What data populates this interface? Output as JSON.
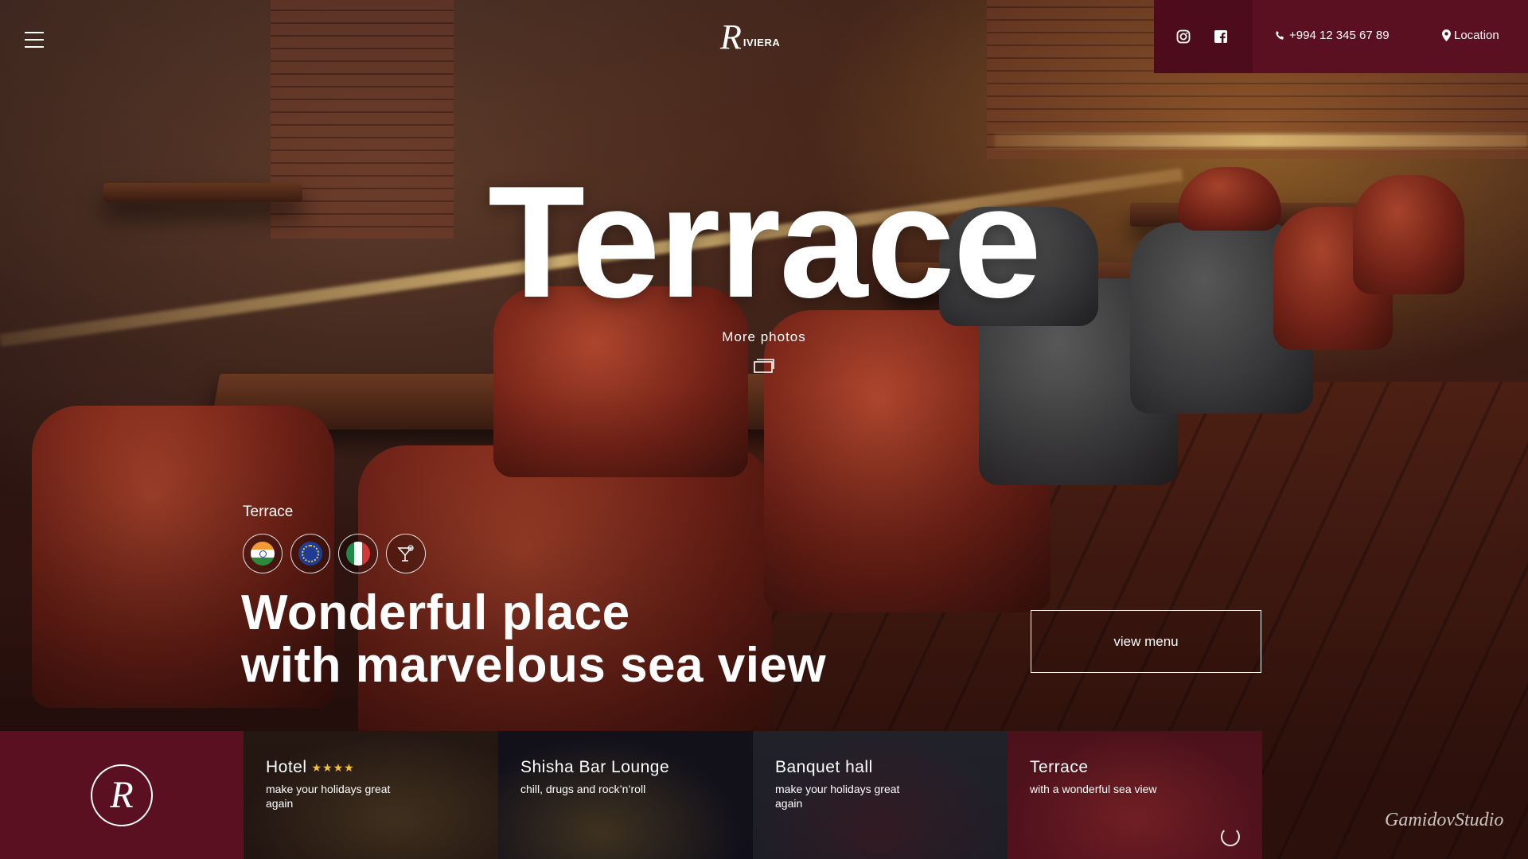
{
  "header": {
    "menu_icon": "hamburger-icon",
    "logo_letter": "R",
    "logo_word": "IVIERA",
    "social": [
      "instagram-icon",
      "facebook-icon"
    ],
    "phone": "+994 12 345 67 89",
    "location": "Location"
  },
  "hero": {
    "title": "Terrace",
    "more_photos": "More photos",
    "section_label": "Terrace",
    "badges": [
      "india-flag-icon",
      "eu-flag-icon",
      "italy-flag-icon",
      "cocktail-icon"
    ],
    "headline_line1": "Wonderful place",
    "headline_line2": "with marvelous sea view",
    "cta": "view menu"
  },
  "bottom": {
    "logo_letter": "R",
    "cards": [
      {
        "title": "Hotel",
        "stars": "★★★★",
        "subtitle": "make your holidays great again"
      },
      {
        "title": "Shisha Bar Lounge",
        "subtitle": "chill, drugs and rock’n’roll"
      },
      {
        "title": "Banquet hall",
        "subtitle": "make your holidays great again"
      },
      {
        "title": "Terrace",
        "subtitle": "with a wonderful sea view"
      }
    ],
    "studio": "GamidovStudio"
  },
  "colors": {
    "accent": "#5b1021",
    "accent_dark": "#4c0c1b",
    "star": "#f3c23a"
  }
}
